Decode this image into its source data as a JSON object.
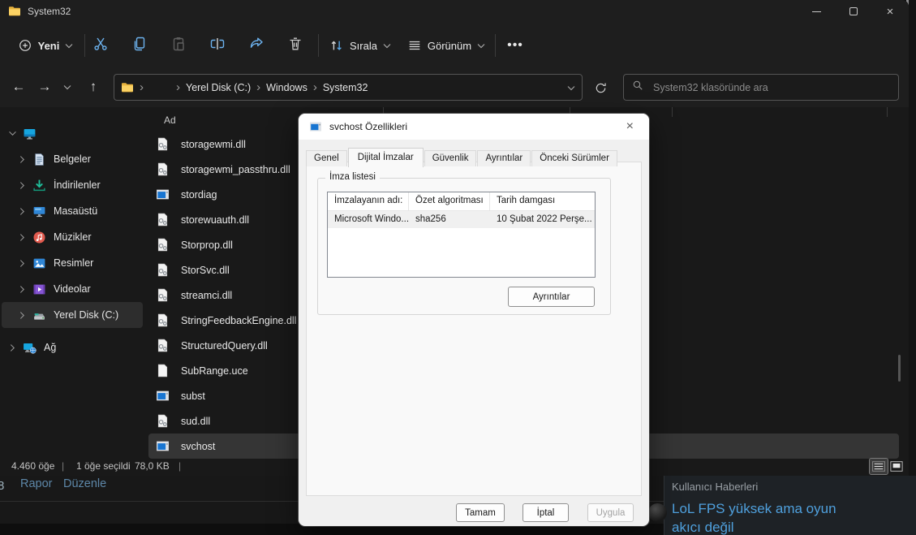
{
  "titlebar": {
    "title": "System32"
  },
  "toolbar": {
    "new": "Yeni",
    "sort": "Sırala",
    "view": "Görünüm"
  },
  "navbar": {
    "crumbs": [
      "Yerel Disk (C:)",
      "Windows",
      "System32"
    ],
    "search_placeholder": "System32 klasöründe ara"
  },
  "sidebar": {
    "items": [
      {
        "icon": "monitor",
        "label": "",
        "name": "this-pc",
        "top": true,
        "expanded": true
      },
      {
        "icon": "document",
        "label": "Belgeler",
        "name": "documents"
      },
      {
        "icon": "download",
        "label": "İndirilenler",
        "name": "downloads"
      },
      {
        "icon": "desktop",
        "label": "Masaüstü",
        "name": "desktop"
      },
      {
        "icon": "music",
        "label": "Müzikler",
        "name": "music"
      },
      {
        "icon": "pictures",
        "label": "Resimler",
        "name": "pictures"
      },
      {
        "icon": "videos",
        "label": "Videolar",
        "name": "videos"
      },
      {
        "icon": "drive",
        "label": "Yerel Disk (C:)",
        "name": "local-disk-c",
        "selected": true
      },
      {
        "icon": "network",
        "label": "Ağ",
        "name": "network",
        "top": true,
        "gap": true
      }
    ]
  },
  "filelist": {
    "header": "Ad",
    "files": [
      {
        "icon": "dll",
        "name": "storagewmi.dll"
      },
      {
        "icon": "dll",
        "name": "storagewmi_passthru.dll"
      },
      {
        "icon": "app",
        "name": "stordiag"
      },
      {
        "icon": "dll",
        "name": "storewuauth.dll"
      },
      {
        "icon": "dll",
        "name": "Storprop.dll"
      },
      {
        "icon": "dll",
        "name": "StorSvc.dll"
      },
      {
        "icon": "dll",
        "name": "streamci.dll"
      },
      {
        "icon": "dll",
        "name": "StringFeedbackEngine.dll"
      },
      {
        "icon": "dll",
        "name": "StructuredQuery.dll"
      },
      {
        "icon": "file",
        "name": "SubRange.uce"
      },
      {
        "icon": "app",
        "name": "subst"
      },
      {
        "icon": "dll",
        "name": "sud.dll"
      },
      {
        "icon": "app",
        "name": "svchost",
        "selected": true
      }
    ]
  },
  "statusbar": {
    "count": "4.460 öğe",
    "divider": "|",
    "selected": "1 öğe seçildi",
    "size": "78,0 KB"
  },
  "dialog": {
    "title": "svchost Özellikleri",
    "tabs": [
      "Genel",
      "Dijital İmzalar",
      "Güvenlik",
      "Ayrıntılar",
      "Önceki Sürümler"
    ],
    "active_tab_index": 1,
    "group_label": "İmza listesi",
    "table": {
      "headers": [
        "İmzalayanın adı:",
        "Özet algoritması",
        "Tarih damgası"
      ],
      "rows": [
        [
          "Microsoft Windo...",
          "sha256",
          "10 Şubat 2022 Perşe..."
        ]
      ]
    },
    "buttons": {
      "details": "Ayrıntılar",
      "ok": "Tamam",
      "cancel": "İptal",
      "apply": "Uygula"
    }
  },
  "background": {
    "partial_char": "8",
    "links": [
      "Rapor",
      "Düzenle"
    ],
    "news_title": "Kullanıcı Haberleri",
    "news_link": "LoL FPS yüksek ama oyun akıcı değil"
  },
  "colors": {
    "accent_blue": "#6cb2ee",
    "link_blue": "#4fa0dd",
    "folder_yellow": "#fbd264",
    "selection_dark": "#353535"
  }
}
